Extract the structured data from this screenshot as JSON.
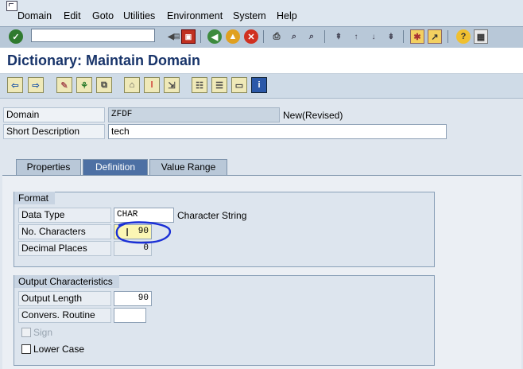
{
  "menu": [
    "Domain",
    "Edit",
    "Goto",
    "Utilities",
    "Environment",
    "System",
    "Help"
  ],
  "title": "Dictionary: Maintain Domain",
  "header": {
    "domain_label": "Domain",
    "domain_value": "ZFDF",
    "status": "New(Revised)",
    "short_desc_label": "Short Description",
    "short_desc_value": "tech"
  },
  "tabs": [
    "Properties",
    "Definition",
    "Value Range"
  ],
  "active_tab": "Definition",
  "format": {
    "title": "Format",
    "data_type_label": "Data Type",
    "data_type_value": "CHAR",
    "data_type_text": "Character String",
    "no_chars_label": "No. Characters",
    "no_chars_value": "90",
    "decimal_label": "Decimal Places",
    "decimal_value": "0"
  },
  "output": {
    "title": "Output Characteristics",
    "length_label": "Output Length",
    "length_value": "90",
    "conv_label": "Convers. Routine",
    "conv_value": "",
    "sign_label": "Sign",
    "lower_label": "Lower Case"
  },
  "colors": {
    "title": "#18346a",
    "active_tab": "#4d70a4",
    "highlight_circle": "#1a2fd6"
  }
}
